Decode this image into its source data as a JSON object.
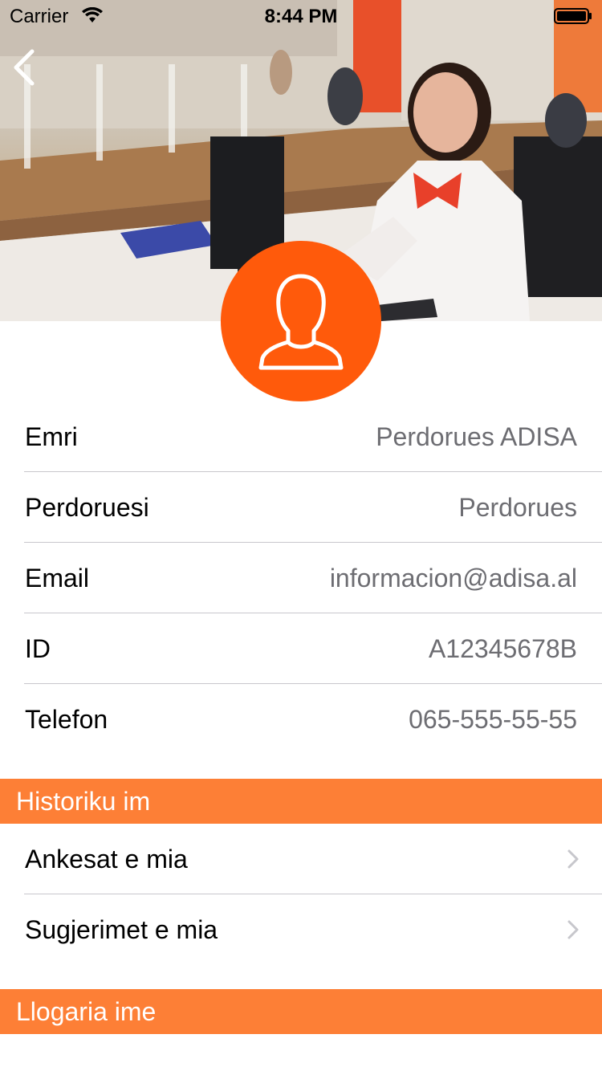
{
  "status_bar": {
    "carrier": "Carrier",
    "time": "8:44 PM"
  },
  "colors": {
    "accent": "#ff5a0b",
    "section_header": "#fd7f36",
    "value_text": "#6d6d72",
    "separator": "#c8c7cc"
  },
  "header": {
    "back_icon": "chevron-left-icon",
    "avatar_icon": "user-silhouette-icon"
  },
  "profile": {
    "rows": [
      {
        "label": "Emri",
        "value": "Perdorues ADISA"
      },
      {
        "label": "Perdoruesi",
        "value": "Perdorues"
      },
      {
        "label": "Email",
        "value": "informacion@adisa.al"
      },
      {
        "label": "ID",
        "value": "A12345678B"
      },
      {
        "label": "Telefon",
        "value": "065-555-55-55"
      }
    ]
  },
  "history": {
    "title": "Historiku im",
    "items": [
      {
        "label": "Ankesat e mia"
      },
      {
        "label": "Sugjerimet e mia"
      }
    ]
  },
  "account": {
    "title": "Llogaria ime"
  }
}
